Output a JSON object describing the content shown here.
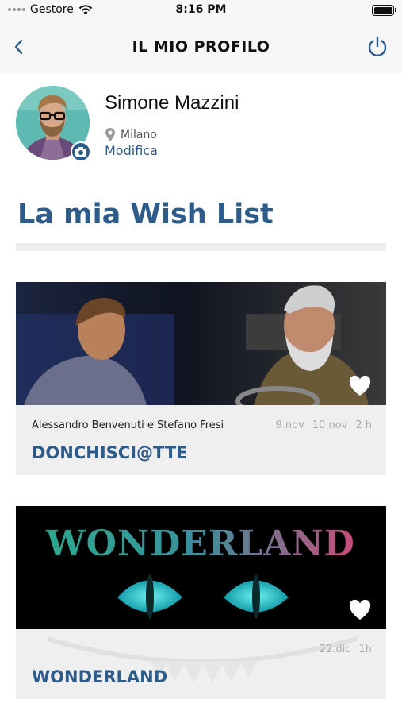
{
  "status_bar": {
    "carrier": "Gestore",
    "time": "8:16 PM"
  },
  "nav": {
    "title": "IL MIO PROFILO",
    "back_icon": "chevron-left-icon",
    "power_icon": "power-icon"
  },
  "profile": {
    "name": "Simone Mazzini",
    "city": "Milano",
    "edit_label": "Modifica",
    "camera_icon": "camera-icon",
    "location_icon": "location-pin-icon"
  },
  "wishlist": {
    "title": "La mia Wish List",
    "items": [
      {
        "artists": "Alessandro Benvenuti e Stefano Fresi",
        "date_from": "9.nov",
        "date_to": "10.nov",
        "duration": "2 h",
        "title": "DONCHISCI@TTE",
        "favorite": true
      },
      {
        "artists": "",
        "date_from": "",
        "date_to": "22.dic",
        "duration": "1h",
        "title": "WONDERLAND",
        "poster_text": "WONDERLAND",
        "favorite": true
      }
    ]
  },
  "colors": {
    "accent": "#2d5c8a",
    "background": "#ffffff",
    "nav_background": "#f7f7f7",
    "card_info_background": "#efefef"
  }
}
